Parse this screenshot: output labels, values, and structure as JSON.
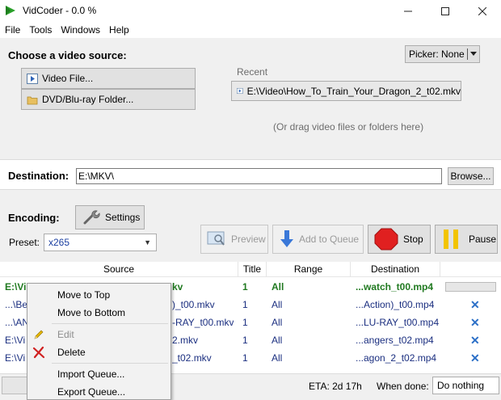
{
  "window": {
    "title": "VidCoder - 0.0 %"
  },
  "menu": [
    "File",
    "Tools",
    "Windows",
    "Help"
  ],
  "source": {
    "heading": "Choose a video source:",
    "video_file_label": "Video File...",
    "folder_label": "DVD/Blu-ray Folder...",
    "recent_label": "Recent",
    "recent_item": "E:\\Video\\How_To_Train_Your_Dragon_2_t02.mkv",
    "drag_hint": "(Or drag video files or folders here)",
    "picker_label": "Picker: None"
  },
  "destination": {
    "label": "Destination:",
    "value": "E:\\MKV\\",
    "browse_label": "Browse..."
  },
  "encoding": {
    "label": "Encoding:",
    "settings_label": "Settings",
    "preset_label": "Preset:",
    "preset_value": "x265",
    "preview_label": "Preview",
    "add_queue_label": "Add to Queue",
    "stop_label": "Stop",
    "pause_label": "Pause"
  },
  "queue": {
    "columns": [
      "Source",
      "Title",
      "Range",
      "Destination"
    ],
    "rows": [
      {
        "source": "E:\\Vi",
        "source_tail": "kv",
        "title": "1",
        "range": "All",
        "destination": "...watch_t00.mp4"
      },
      {
        "source": "...\\Be",
        "source_tail": ")_t00.mkv",
        "title": "1",
        "range": "All",
        "destination": "...Action)_t00.mp4"
      },
      {
        "source": "...\\AN",
        "source_tail": "-RAY_t00.mkv",
        "title": "1",
        "range": "All",
        "destination": "...LU-RAY_t00.mp4"
      },
      {
        "source": "E:\\Vi",
        "source_tail": "2.mkv",
        "title": "1",
        "range": "All",
        "destination": "...angers_t02.mp4"
      },
      {
        "source": "E:\\Vi",
        "source_tail": "_t02.mkv",
        "title": "1",
        "range": "All",
        "destination": "...agon_2_t02.mp4"
      }
    ]
  },
  "status": {
    "eta": "ETA: 2d 17h",
    "when_done_label": "When done:",
    "when_done_value": "Do nothing"
  },
  "context_menu": {
    "move_top": "Move to Top",
    "move_bottom": "Move to Bottom",
    "edit": "Edit",
    "delete": "Delete",
    "import": "Import Queue...",
    "export": "Export Queue..."
  },
  "colors": {
    "accent_green": "#217a21",
    "link_blue": "#1b2f80",
    "stop_red": "#e02020",
    "pause_yellow": "#f2c400"
  }
}
